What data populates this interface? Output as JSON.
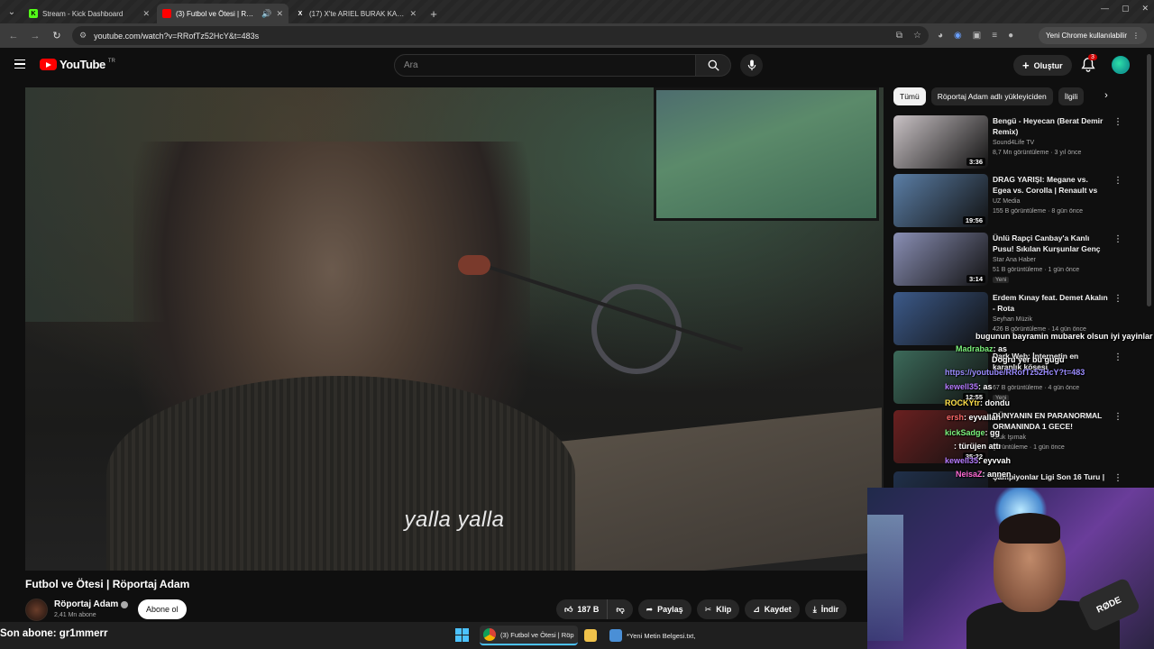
{
  "browser": {
    "tabs": [
      {
        "label": "Stream - Kick Dashboard",
        "fav": "K",
        "fav_color": "#53fc18"
      },
      {
        "label": "(3) Futbol ve Ötesi | Röportaj",
        "fav": "",
        "fav_color": "#ff0000"
      },
      {
        "label": "(17) X'te ARIEL BURAK KAPLAN",
        "fav": "X",
        "fav_color": "#000000"
      }
    ],
    "url": "youtube.com/watch?v=RRofTz52HcY&t=483s",
    "update_label": "Yeni Chrome kullanılabilir"
  },
  "youtube": {
    "logo_text": "YouTube",
    "country": "TR",
    "search_placeholder": "Ara",
    "create_label": "Oluştur",
    "notif_count": "3"
  },
  "video": {
    "subtitle": "yalla yalla",
    "title": "Futbol ve Ötesi | Röportaj Adam",
    "channel": "Röportaj Adam",
    "subscribers": "2,41 Mn abone",
    "subscribe_label": "Abone ol",
    "likes": "187 B",
    "share_label": "Paylaş",
    "clip_label": "Klip",
    "save_label": "Kaydet",
    "download_label": "İndir"
  },
  "sidebar": {
    "chips": [
      "Tümü",
      "Röportaj Adam adlı yükleyiciden",
      "İlgili"
    ],
    "recommendations": [
      {
        "title": "Bengü - Heyecan (Berat Demir Remix)",
        "channel": "Sound4Life TV",
        "meta": "8,7 Mn görüntüleme · 3 yıl önce",
        "duration": "3:36",
        "badge": "",
        "thumb_color": "#c9c2c5"
      },
      {
        "title": "DRAG YARIŞI: Megane vs. Egea vs. Corolla | Renault vs Toyota ...",
        "channel": "UZ Media",
        "meta": "155 B görüntüleme · 8 gün önce",
        "duration": "19:56",
        "badge": "",
        "thumb_color": "#5b7ea6"
      },
      {
        "title": "Ünlü Rapçi Canbay'a Kanlı Pusu! Sıkılan Kurşunlar Genç ...",
        "channel": "Star Ana Haber",
        "meta": "51 B görüntüleme · 1 gün önce",
        "duration": "3:14",
        "badge": "Yeni",
        "thumb_color": "#8a8fb5"
      },
      {
        "title": "Erdem Kınay feat. Demet Akalın - Rota",
        "channel": "Seyhan Müzik",
        "meta": "426 B görüntüleme · 14 gün önce",
        "duration": "",
        "badge": "",
        "thumb_color": "#3c5a8a"
      },
      {
        "title": "Dark Web: İnternetin en karanlık köşesi",
        "channel": "",
        "meta": "67 B görüntüleme · 4 gün önce",
        "duration": "12:55",
        "badge": "Yeni",
        "thumb_color": "#3c6a5a"
      },
      {
        "title": "DÜNYANIN EN PARANORMAL ORMANINDA 1 GECE!",
        "channel": "Ufuk Işımak",
        "meta": "görüntüleme · 1 gün önce",
        "duration": "35:22",
        "badge": "",
        "thumb_color": "#6a2020"
      },
      {
        "title": "Şampiyonlar Ligi Son 16 Turu | ...",
        "channel": "",
        "meta": "",
        "duration": "",
        "badge": "",
        "thumb_color": "#20304a"
      }
    ]
  },
  "chat": [
    {
      "user": "",
      "msg": "bugunun bayramin mubarek olsun iyi yayinlar",
      "color": "#ffffff"
    },
    {
      "user": "Madrabaz",
      "msg": ": as",
      "color": "#7cf27c"
    },
    {
      "user": "",
      "msg": "Dogru yer bu gugu",
      "color": "#ffffff"
    },
    {
      "user": "",
      "msg": "https://youtube/RRofTz52HcY?t=483",
      "color": "#9b8cff"
    },
    {
      "user": "kewell35",
      "msg": ": as",
      "color": "#b57cff"
    },
    {
      "user": "ROCKYtr",
      "msg": ": dondu",
      "color": "#ffe04a"
    },
    {
      "user": "ersh",
      "msg": ": eyvallah",
      "color": "#ff6a6a"
    },
    {
      "user": "kickSadge",
      "msg": ": gg",
      "color": "#7cf27c"
    },
    {
      "user": "",
      "msg": ": türüjen attı",
      "color": "#ffffff"
    },
    {
      "user": "kewell35",
      "msg": ": eyvvah",
      "color": "#b57cff"
    },
    {
      "user": "NeisaZ",
      "msg": ": annen",
      "color": "#ff6ad5"
    }
  ],
  "stream_overlay": {
    "last_sub": "Son abone: gr1mmerr",
    "cam_mic_label": "RØDE"
  },
  "taskbar": {
    "items": [
      {
        "label": "(3) Futbol ve Ötesi | Röp",
        "color": "#e8b23a"
      },
      {
        "label": "",
        "color": "#f0c24a"
      },
      {
        "label": "*Yeni Metin Belgesi.txt, ",
        "color": "#4a8fd6"
      }
    ]
  }
}
